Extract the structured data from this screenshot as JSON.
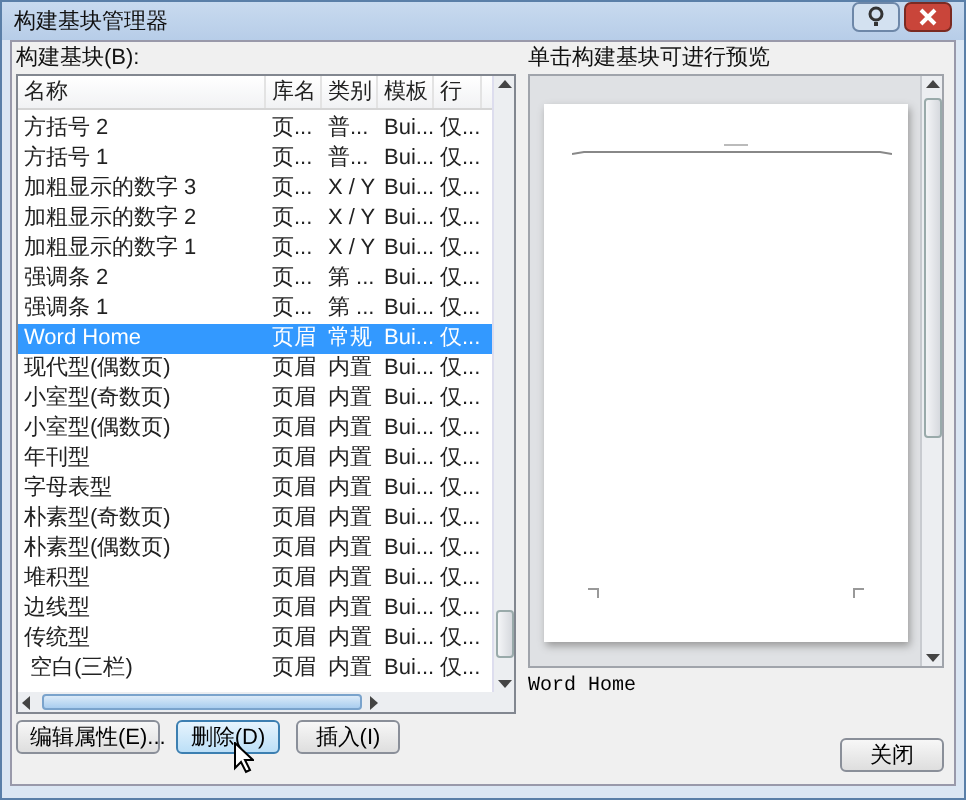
{
  "window": {
    "title": "构建基块管理器"
  },
  "list": {
    "label": "构建基块(B):",
    "columns": [
      "名称",
      "库名",
      "类别",
      "模板",
      "行"
    ],
    "rows": [
      {
        "cells": [
          "方括号 2",
          "页...",
          "普...",
          "Bui...",
          "仅..."
        ],
        "selected": false
      },
      {
        "cells": [
          "方括号 1",
          "页...",
          "普...",
          "Bui...",
          "仅..."
        ],
        "selected": false
      },
      {
        "cells": [
          "加粗显示的数字 3",
          "页...",
          "X / Y",
          "Bui...",
          "仅..."
        ],
        "selected": false
      },
      {
        "cells": [
          "加粗显示的数字 2",
          "页...",
          "X / Y",
          "Bui...",
          "仅..."
        ],
        "selected": false
      },
      {
        "cells": [
          "加粗显示的数字 1",
          "页...",
          "X / Y",
          "Bui...",
          "仅..."
        ],
        "selected": false
      },
      {
        "cells": [
          "强调条 2",
          "页...",
          "第 ...",
          "Bui...",
          "仅..."
        ],
        "selected": false
      },
      {
        "cells": [
          "强调条 1",
          "页...",
          "第 ...",
          "Bui...",
          "仅..."
        ],
        "selected": false
      },
      {
        "cells": [
          "Word Home",
          "页眉",
          "常规",
          "Bui...",
          "仅..."
        ],
        "selected": true
      },
      {
        "cells": [
          "现代型(偶数页)",
          "页眉",
          "内置",
          "Bui...",
          "仅..."
        ],
        "selected": false
      },
      {
        "cells": [
          "小室型(奇数页)",
          "页眉",
          "内置",
          "Bui...",
          "仅..."
        ],
        "selected": false
      },
      {
        "cells": [
          "小室型(偶数页)",
          "页眉",
          "内置",
          "Bui...",
          "仅..."
        ],
        "selected": false
      },
      {
        "cells": [
          "年刊型",
          "页眉",
          "内置",
          "Bui...",
          "仅..."
        ],
        "selected": false
      },
      {
        "cells": [
          "字母表型",
          "页眉",
          "内置",
          "Bui...",
          "仅..."
        ],
        "selected": false
      },
      {
        "cells": [
          "朴素型(奇数页)",
          "页眉",
          "内置",
          "Bui...",
          "仅..."
        ],
        "selected": false
      },
      {
        "cells": [
          "朴素型(偶数页)",
          "页眉",
          "内置",
          "Bui...",
          "仅..."
        ],
        "selected": false
      },
      {
        "cells": [
          "堆积型",
          "页眉",
          "内置",
          "Bui...",
          "仅..."
        ],
        "selected": false
      },
      {
        "cells": [
          "边线型",
          "页眉",
          "内置",
          "Bui...",
          "仅..."
        ],
        "selected": false
      },
      {
        "cells": [
          "传统型",
          "页眉",
          "内置",
          "Bui...",
          "仅..."
        ],
        "selected": false
      },
      {
        "cells": [
          " 空白(三栏)",
          "页眉",
          "内置",
          "Bui...",
          "仅..."
        ],
        "selected": false
      }
    ]
  },
  "buttons": [
    {
      "label": "编辑属性(E)...",
      "hovered": false
    },
    {
      "label": "删除(D)",
      "hovered": true
    },
    {
      "label": "插入(I)",
      "hovered": false
    }
  ],
  "preview": {
    "label": "单击构建基块可进行预览",
    "caption": "Word Home"
  },
  "close_button": "关闭"
}
